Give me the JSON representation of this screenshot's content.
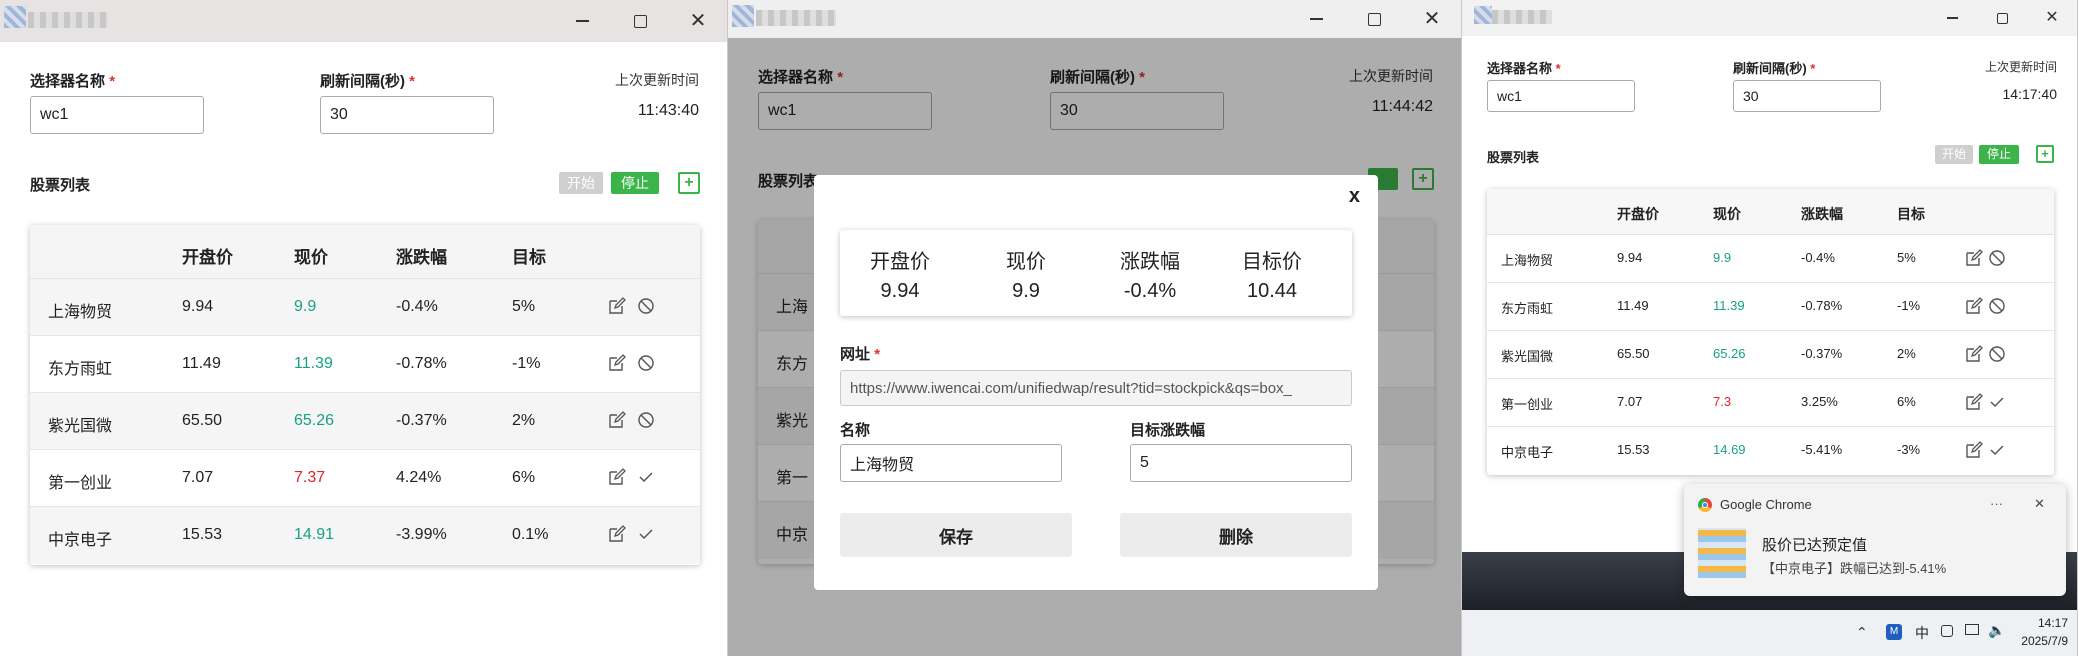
{
  "labels": {
    "selector_name": "选择器名称",
    "refresh_interval": "刷新间隔(秒)",
    "required_mark": "*",
    "last_update": "上次更新时间",
    "stock_list": "股票列表",
    "start": "开始",
    "stop": "停止",
    "add": "+"
  },
  "table_headers": [
    "开盘价",
    "现价",
    "涨跌幅",
    "目标"
  ],
  "icons": {
    "edit": "edit-icon",
    "disable": "ban-icon",
    "check": "check-icon"
  },
  "colors": {
    "green": "#16a085",
    "red": "#e0242c",
    "stop_button": "#3bb54a",
    "start_button": "#cfcfcf"
  },
  "window1": {
    "selector_value": "wc1",
    "interval_value": "30",
    "last_update_time": "11:43:40",
    "rows": [
      {
        "name": "上海物贸",
        "open": "9.94",
        "price": "9.9",
        "price_color": "green",
        "change": "-0.4%",
        "target": "5%",
        "status": "ban"
      },
      {
        "name": "东方雨虹",
        "open": "11.49",
        "price": "11.39",
        "price_color": "green",
        "change": "-0.78%",
        "target": "-1%",
        "status": "ban"
      },
      {
        "name": "紫光国微",
        "open": "65.50",
        "price": "65.26",
        "price_color": "green",
        "change": "-0.37%",
        "target": "2%",
        "status": "ban"
      },
      {
        "name": "第一创业",
        "open": "7.07",
        "price": "7.37",
        "price_color": "red",
        "change": "4.24%",
        "target": "6%",
        "status": "check"
      },
      {
        "name": "中京电子",
        "open": "15.53",
        "price": "14.91",
        "price_color": "green",
        "change": "-3.99%",
        "target": "0.1%",
        "status": "check"
      }
    ]
  },
  "window2": {
    "selector_value": "wc1",
    "interval_value": "30",
    "last_update_time": "11:44:42",
    "bg_rows": [
      "上海",
      "东方",
      "紫光",
      "第一",
      "中京"
    ],
    "modal": {
      "close": "x",
      "quote_headers": [
        "开盘价",
        "现价",
        "涨跌幅",
        "目标价"
      ],
      "quote_values": [
        "9.94",
        "9.9",
        "-0.4%",
        "10.44"
      ],
      "url_label": "网址",
      "url_value": "https://www.iwencai.com/unifiedwap/result?tid=stockpick&qs=box_",
      "name_label": "名称",
      "name_value": "上海物贸",
      "target_label": "目标涨跌幅",
      "target_value": "5",
      "save": "保存",
      "delete": "删除"
    }
  },
  "window3": {
    "selector_value": "wc1",
    "interval_value": "30",
    "last_update_time": "14:17:40",
    "rows": [
      {
        "name": "上海物贸",
        "open": "9.94",
        "price": "9.9",
        "price_color": "green",
        "change": "-0.4%",
        "target": "5%",
        "status": "ban"
      },
      {
        "name": "东方雨虹",
        "open": "11.49",
        "price": "11.39",
        "price_color": "green",
        "change": "-0.78%",
        "target": "-1%",
        "status": "ban"
      },
      {
        "name": "紫光国微",
        "open": "65.50",
        "price": "65.26",
        "price_color": "green",
        "change": "-0.37%",
        "target": "2%",
        "status": "ban"
      },
      {
        "name": "第一创业",
        "open": "7.07",
        "price": "7.3",
        "price_color": "red",
        "change": "3.25%",
        "target": "6%",
        "status": "check"
      },
      {
        "name": "中京电子",
        "open": "15.53",
        "price": "14.69",
        "price_color": "green",
        "change": "-5.41%",
        "target": "-3%",
        "status": "check"
      }
    ],
    "notification": {
      "app": "Google Chrome",
      "more": "···",
      "close": "✕",
      "title": "股价已达预定值",
      "body": "【中京电子】跌幅已达到-5.41%"
    },
    "taskbar": {
      "ime": "中",
      "time": "14:17",
      "date": "2025/7/9"
    }
  }
}
